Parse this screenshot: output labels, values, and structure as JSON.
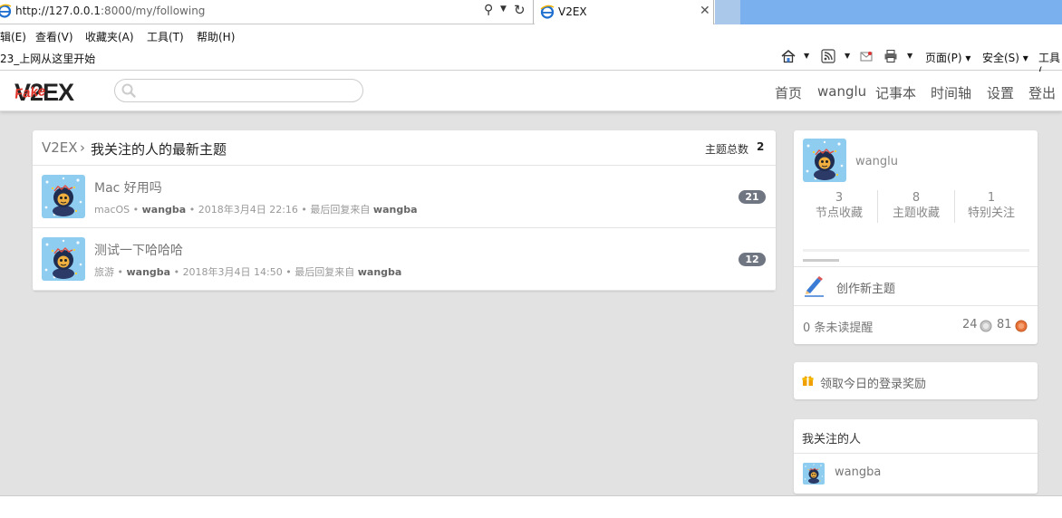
{
  "browser": {
    "url_host": "http://127.0.0.1",
    "url_path": ":8000/my/following",
    "tab_title": "V2EX",
    "menu": [
      "辑(E)",
      "查看(V)",
      "收藏夹(A)",
      "工具(T)",
      "帮助(H)"
    ],
    "favorites_link": "23_上网从这里开始",
    "toolbar": {
      "page": "页面(P)",
      "safety": "安全(S)",
      "tools": "工具("
    }
  },
  "site": {
    "logo_text": "V2EX",
    "logo_overlay": "Fake",
    "search_placeholder": "",
    "nav": [
      "首页",
      "wanglu",
      "记事本",
      "时间轴",
      "设置",
      "登出"
    ]
  },
  "main": {
    "breadcrumb_root": "V2EX",
    "breadcrumb_sep": "›",
    "breadcrumb_current": "我关注的人的最新主题",
    "total_label": "主题总数",
    "total_count": "2",
    "topics": [
      {
        "title": "Mac 好用吗",
        "node": "macOS",
        "author": "wangba",
        "time": "2018年3月4日 22:16",
        "last_reply_label": "最后回复来自",
        "last_reply_by": "wangba",
        "replies": "21"
      },
      {
        "title": "测试一下哈哈哈",
        "node": "旅游",
        "author": "wangba",
        "time": "2018年3月4日 14:50",
        "last_reply_label": "最后回复来自",
        "last_reply_by": "wangba",
        "replies": "12"
      }
    ]
  },
  "sidebar": {
    "username": "wanglu",
    "stats": [
      {
        "num": "3",
        "label": "节点收藏"
      },
      {
        "num": "8",
        "label": "主题收藏"
      },
      {
        "num": "1",
        "label": "特别关注"
      }
    ],
    "new_topic": "创作新主题",
    "unread": "0 条未读提醒",
    "silver": "24",
    "bronze": "81",
    "reward": "领取今日的登录奖励",
    "following_title": "我关注的人",
    "following": [
      {
        "name": "wangba"
      }
    ]
  },
  "colors": {
    "ie_blue": "#1e6fd0",
    "logo_red": "#e0352b",
    "count_badge": "#6f7581",
    "reward_gold": "#f0a000"
  }
}
